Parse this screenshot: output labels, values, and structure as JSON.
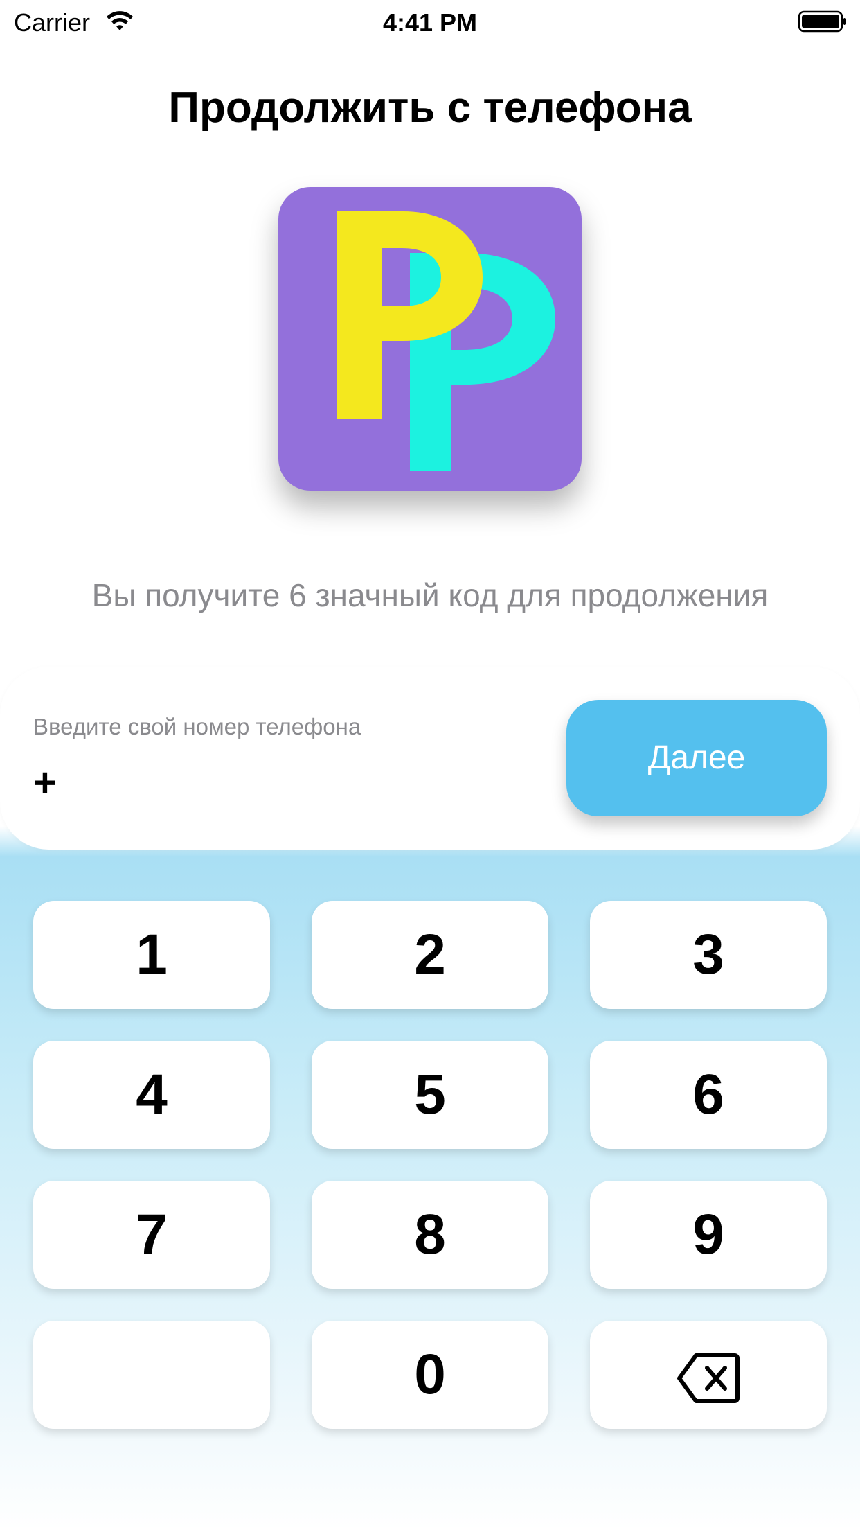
{
  "status_bar": {
    "carrier": "Carrier",
    "time": "4:41 PM",
    "icons": [
      "wifi-icon",
      "battery-icon"
    ]
  },
  "header": {
    "title": "Продолжить с телефона"
  },
  "logo": {
    "colors": {
      "background": "#9370db",
      "letter_front": "#f4e81e",
      "letter_back": "#1cf2e0"
    }
  },
  "subtitle": "Вы получите 6 значный код для продолжения",
  "phone_form": {
    "label": "Введите свой номер телефона",
    "value": "+",
    "next_button": "Далее"
  },
  "keypad": {
    "keys": [
      "1",
      "2",
      "3",
      "4",
      "5",
      "6",
      "7",
      "8",
      "9",
      "",
      "0",
      ""
    ],
    "delete_icon": "backspace-icon"
  },
  "colors": {
    "accent": "#54c0ee",
    "gradient_top": "#a9dff4",
    "gradient_bottom": "#ffffff"
  }
}
